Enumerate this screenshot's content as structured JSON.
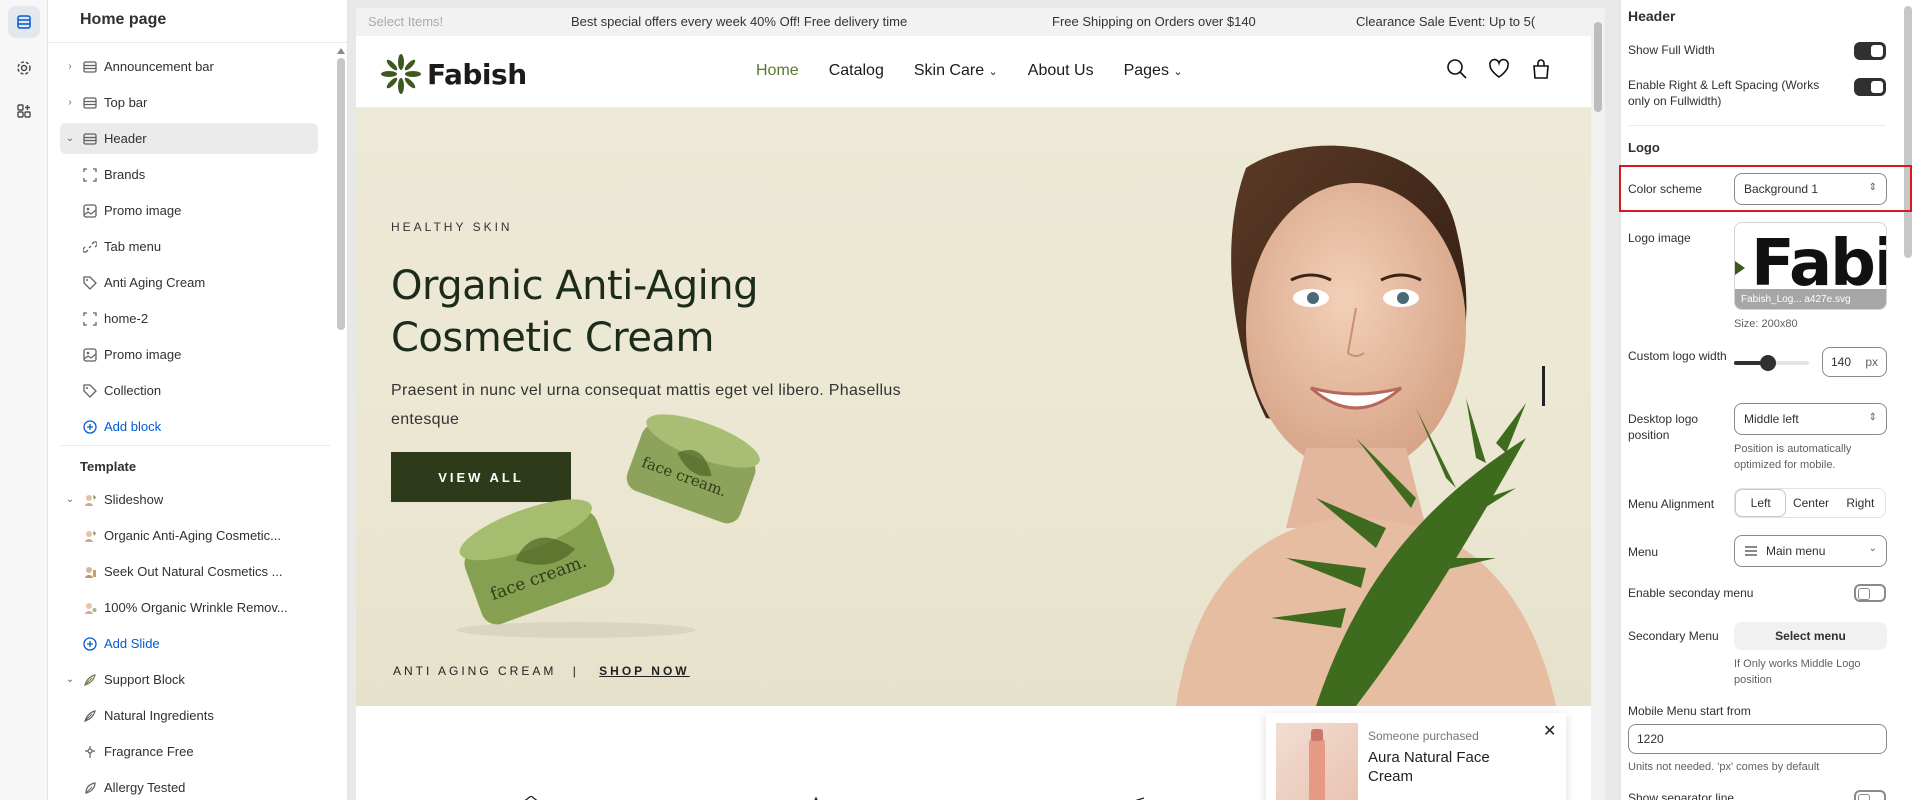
{
  "left": {
    "title": "Home page",
    "sections": [
      {
        "label": "Announcement bar",
        "icon": "section-icon",
        "chevron": "chevron-right-icon"
      },
      {
        "label": "Top bar",
        "icon": "section-icon",
        "chevron": "chevron-right-icon"
      },
      {
        "label": "Header",
        "icon": "section-icon",
        "chevron": "chevron-down-icon",
        "selected": true
      }
    ],
    "header_blocks": [
      {
        "label": "Brands",
        "icon": "block-frame-icon"
      },
      {
        "label": "Promo image",
        "icon": "image-icon"
      },
      {
        "label": "Tab menu",
        "icon": "link-icon"
      },
      {
        "label": "Anti Aging Cream",
        "icon": "tag-icon"
      },
      {
        "label": "home-2",
        "icon": "block-frame-icon"
      },
      {
        "label": "Promo image",
        "icon": "image-icon"
      },
      {
        "label": "Collection",
        "icon": "tag-icon"
      }
    ],
    "add_block": "Add block",
    "template_title": "Template",
    "slideshow": {
      "label": "Slideshow",
      "slides": [
        "Organic Anti-Aging Cosmetic...",
        "Seek Out Natural Cosmetics ...",
        "100% Organic Wrinkle Remov..."
      ],
      "add_slide": "Add Slide"
    },
    "support": {
      "label": "Support Block",
      "items": [
        "Natural Ingredients",
        "Fragrance Free",
        "Allergy Tested"
      ]
    }
  },
  "preview": {
    "announcements": [
      "Select Items!",
      "Best special offers every week 40% Off! Free delivery time",
      "Free Shipping on Orders over $140",
      "Clearance Sale Event: Up to 5("
    ],
    "logo": "Fabish",
    "menu": [
      "Home",
      "Catalog",
      "Skin Care",
      "About Us",
      "Pages"
    ],
    "hero": {
      "tag": "HEALTHY SKIN",
      "title": "Organic Anti-Aging Cosmetic Cream",
      "desc": "Praesent in nunc vel urna consequat mattis eget vel libero. Phasellus entesque",
      "button": "VIEW ALL",
      "bottom_left": "ANTI AGING CREAM",
      "bottom_sep": "|",
      "bottom_link": "SHOP NOW",
      "jar_text": "face cream."
    },
    "toast": {
      "label": "Someone purchased",
      "product": "Aura Natural Face Cream",
      "close": "✕"
    }
  },
  "right": {
    "title": "Header",
    "show_full_width": "Show Full Width",
    "spacing": "Enable Right & Left Spacing (Works only on Fullwidth)",
    "logo_title": "Logo",
    "color_scheme_label": "Color scheme",
    "color_scheme_value": "Background 1",
    "logo_image_label": "Logo image",
    "logo_preview_text": "Fabi",
    "logo_filename": "Fabish_Log... a427e.svg",
    "logo_size": "Size: 200x80",
    "custom_logo_width_label": "Custom logo width",
    "custom_logo_width_value": "140",
    "custom_logo_width_unit": "px",
    "custom_logo_width_level": 0.45,
    "desktop_logo_position_label": "Desktop logo position",
    "desktop_logo_position_value": "Middle left",
    "desktop_logo_position_hint": "Position is automatically optimized for mobile.",
    "menu_alignment_label": "Menu Alignment",
    "menu_alignment_options": [
      "Left",
      "Center",
      "Right"
    ],
    "menu_label": "Menu",
    "menu_value": "Main menu",
    "secondary_toggle_label": "Enable seconday menu",
    "secondary_menu_label": "Secondary Menu",
    "secondary_menu_button": "Select menu",
    "secondary_menu_hint": "If Only works Middle Logo position",
    "mobile_menu_label": "Mobile Menu start from",
    "mobile_menu_value": "1220",
    "mobile_menu_hint": "Units not needed. 'px' comes by default",
    "cut_label": "Show separator line"
  }
}
